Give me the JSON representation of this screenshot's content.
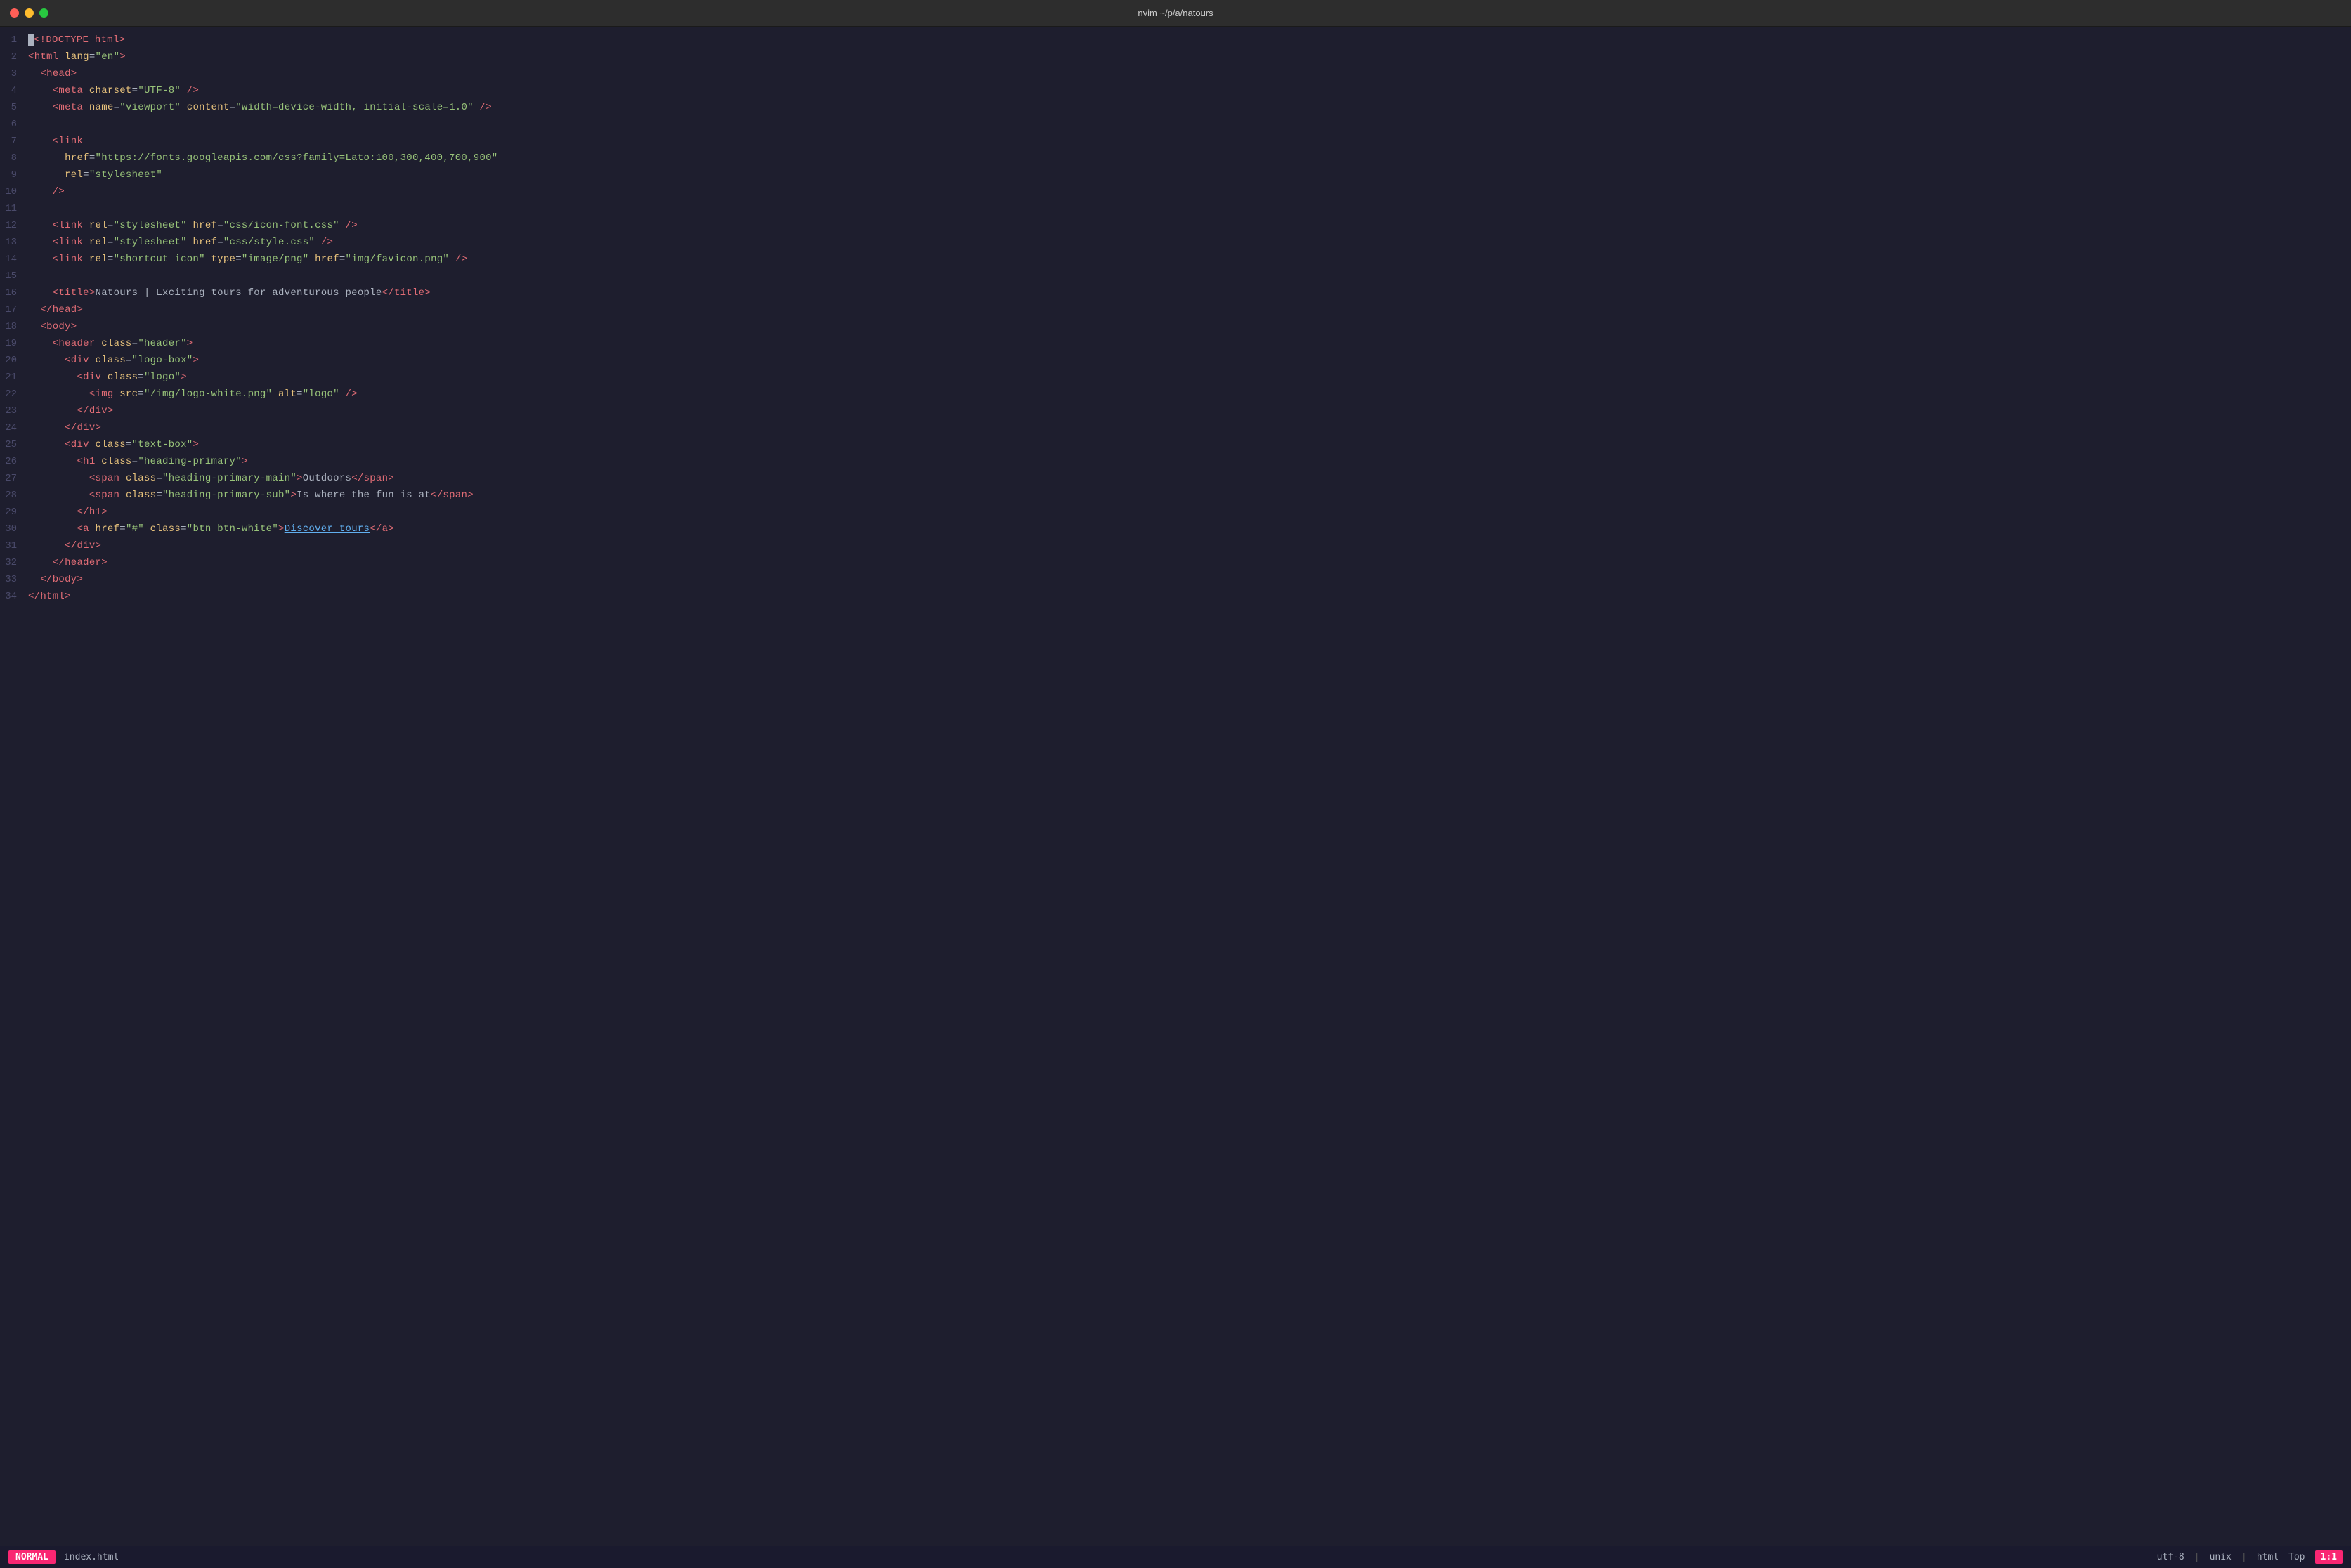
{
  "titlebar": {
    "title": "nvim ~/p/a/natours"
  },
  "editor": {
    "lines": [
      {
        "num": 1,
        "tokens": [
          {
            "type": "cursor"
          },
          {
            "type": "tag",
            "text": "<!DOCTYPE html>"
          },
          {
            "type": "text",
            "text": ""
          }
        ]
      },
      {
        "num": 2,
        "raw": "<html lang=\"en\">"
      },
      {
        "num": 3,
        "raw": "  <head>"
      },
      {
        "num": 4,
        "raw": "    <meta charset=\"UTF-8\" />"
      },
      {
        "num": 5,
        "raw": "    <meta name=\"viewport\" content=\"width=device-width, initial-scale=1.0\" />"
      },
      {
        "num": 6,
        "raw": ""
      },
      {
        "num": 7,
        "raw": "    <link"
      },
      {
        "num": 8,
        "raw": "      href=\"https://fonts.googleapis.com/css?family=Lato:100,300,400,700,900\""
      },
      {
        "num": 9,
        "raw": "      rel=\"stylesheet\""
      },
      {
        "num": 10,
        "raw": "    />"
      },
      {
        "num": 11,
        "raw": ""
      },
      {
        "num": 12,
        "raw": "    <link rel=\"stylesheet\" href=\"css/icon-font.css\" />"
      },
      {
        "num": 13,
        "raw": "    <link rel=\"stylesheet\" href=\"css/style.css\" />"
      },
      {
        "num": 14,
        "raw": "    <link rel=\"shortcut icon\" type=\"image/png\" href=\"img/favicon.png\" />"
      },
      {
        "num": 15,
        "raw": ""
      },
      {
        "num": 16,
        "raw": "    <title>Natours | Exciting tours for adventurous people</title>"
      },
      {
        "num": 17,
        "raw": "  </head>"
      },
      {
        "num": 18,
        "raw": "  <body>"
      },
      {
        "num": 19,
        "raw": "    <header class=\"header\">"
      },
      {
        "num": 20,
        "raw": "      <div class=\"logo-box\">"
      },
      {
        "num": 21,
        "raw": "        <div class=\"logo\">"
      },
      {
        "num": 22,
        "raw": "          <img src=\"/img/logo-white.png\" alt=\"logo\" />"
      },
      {
        "num": 23,
        "raw": "        </div>"
      },
      {
        "num": 24,
        "raw": "      </div>"
      },
      {
        "num": 25,
        "raw": "      <div class=\"text-box\">"
      },
      {
        "num": 26,
        "raw": "        <h1 class=\"heading-primary\">"
      },
      {
        "num": 27,
        "raw": "          <span class=\"heading-primary-main\">Outdoors</span>"
      },
      {
        "num": 28,
        "raw": "          <span class=\"heading-primary-sub\">Is where the fun is at</span>"
      },
      {
        "num": 29,
        "raw": "        </h1>"
      },
      {
        "num": 30,
        "raw": "        <a href=\"#\" class=\"btn btn-white\">Discover tours</a>"
      },
      {
        "num": 31,
        "raw": "      </div>"
      },
      {
        "num": 32,
        "raw": "    </header>"
      },
      {
        "num": 33,
        "raw": "  </body>"
      },
      {
        "num": 34,
        "raw": "</html>"
      }
    ]
  },
  "statusbar": {
    "mode": "NORMAL",
    "filename": "index.html",
    "encoding": "utf-8",
    "lineending": "unix",
    "filetype": "html",
    "position": "Top",
    "cursor": "1:1"
  }
}
